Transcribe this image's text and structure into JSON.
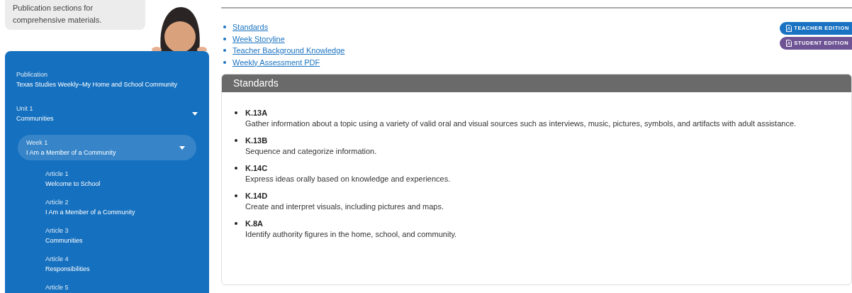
{
  "bubble": {
    "text": "Publication sections for comprehensive materials."
  },
  "sidebar": {
    "publication": {
      "label": "Publication",
      "title": "Texas Studies Weekly–My Home and School Community"
    },
    "items": [
      {
        "label": "Unit 1",
        "title": "Communities",
        "expanded": true,
        "selected": false,
        "children": [
          {
            "label": "Week 1",
            "title": "I Am a Member of a Community",
            "expanded": true,
            "selected": true,
            "children": [
              {
                "label": "Article 1",
                "title": "Welcome to School",
                "selected": false
              },
              {
                "label": "Article 2",
                "title": "I Am a Member of a Community",
                "selected": false
              },
              {
                "label": "Article 3",
                "title": "Communities",
                "selected": false
              },
              {
                "label": "Article 4",
                "title": "Responsibilities",
                "selected": false
              },
              {
                "label": "Article 5",
                "selected": false
              }
            ]
          }
        ]
      }
    ]
  },
  "links": [
    "Standards",
    "Week Storyline",
    "Teacher Background Knowledge",
    "Weekly Assessment PDF"
  ],
  "edition_buttons": [
    {
      "label": "TEACHER EDITION",
      "color": "#1a73c2"
    },
    {
      "label": "STUDENT EDITION",
      "color": "#6e5494"
    }
  ],
  "standards": {
    "title": "Standards",
    "items": [
      {
        "code": "K.13A",
        "text": "Gather information about a topic using a variety of valid oral and visual sources such as interviews, music, pictures, symbols, and artifacts with adult assistance."
      },
      {
        "code": "K.13B",
        "text": "Sequence and categorize information."
      },
      {
        "code": "K.14C",
        "text": "Express ideas orally based on knowledge and experiences."
      },
      {
        "code": "K.14D",
        "text": "Create and interpret visuals, including pictures and maps."
      },
      {
        "code": "K.8A",
        "text": "Identify authority figures in the home, school, and community."
      }
    ]
  }
}
